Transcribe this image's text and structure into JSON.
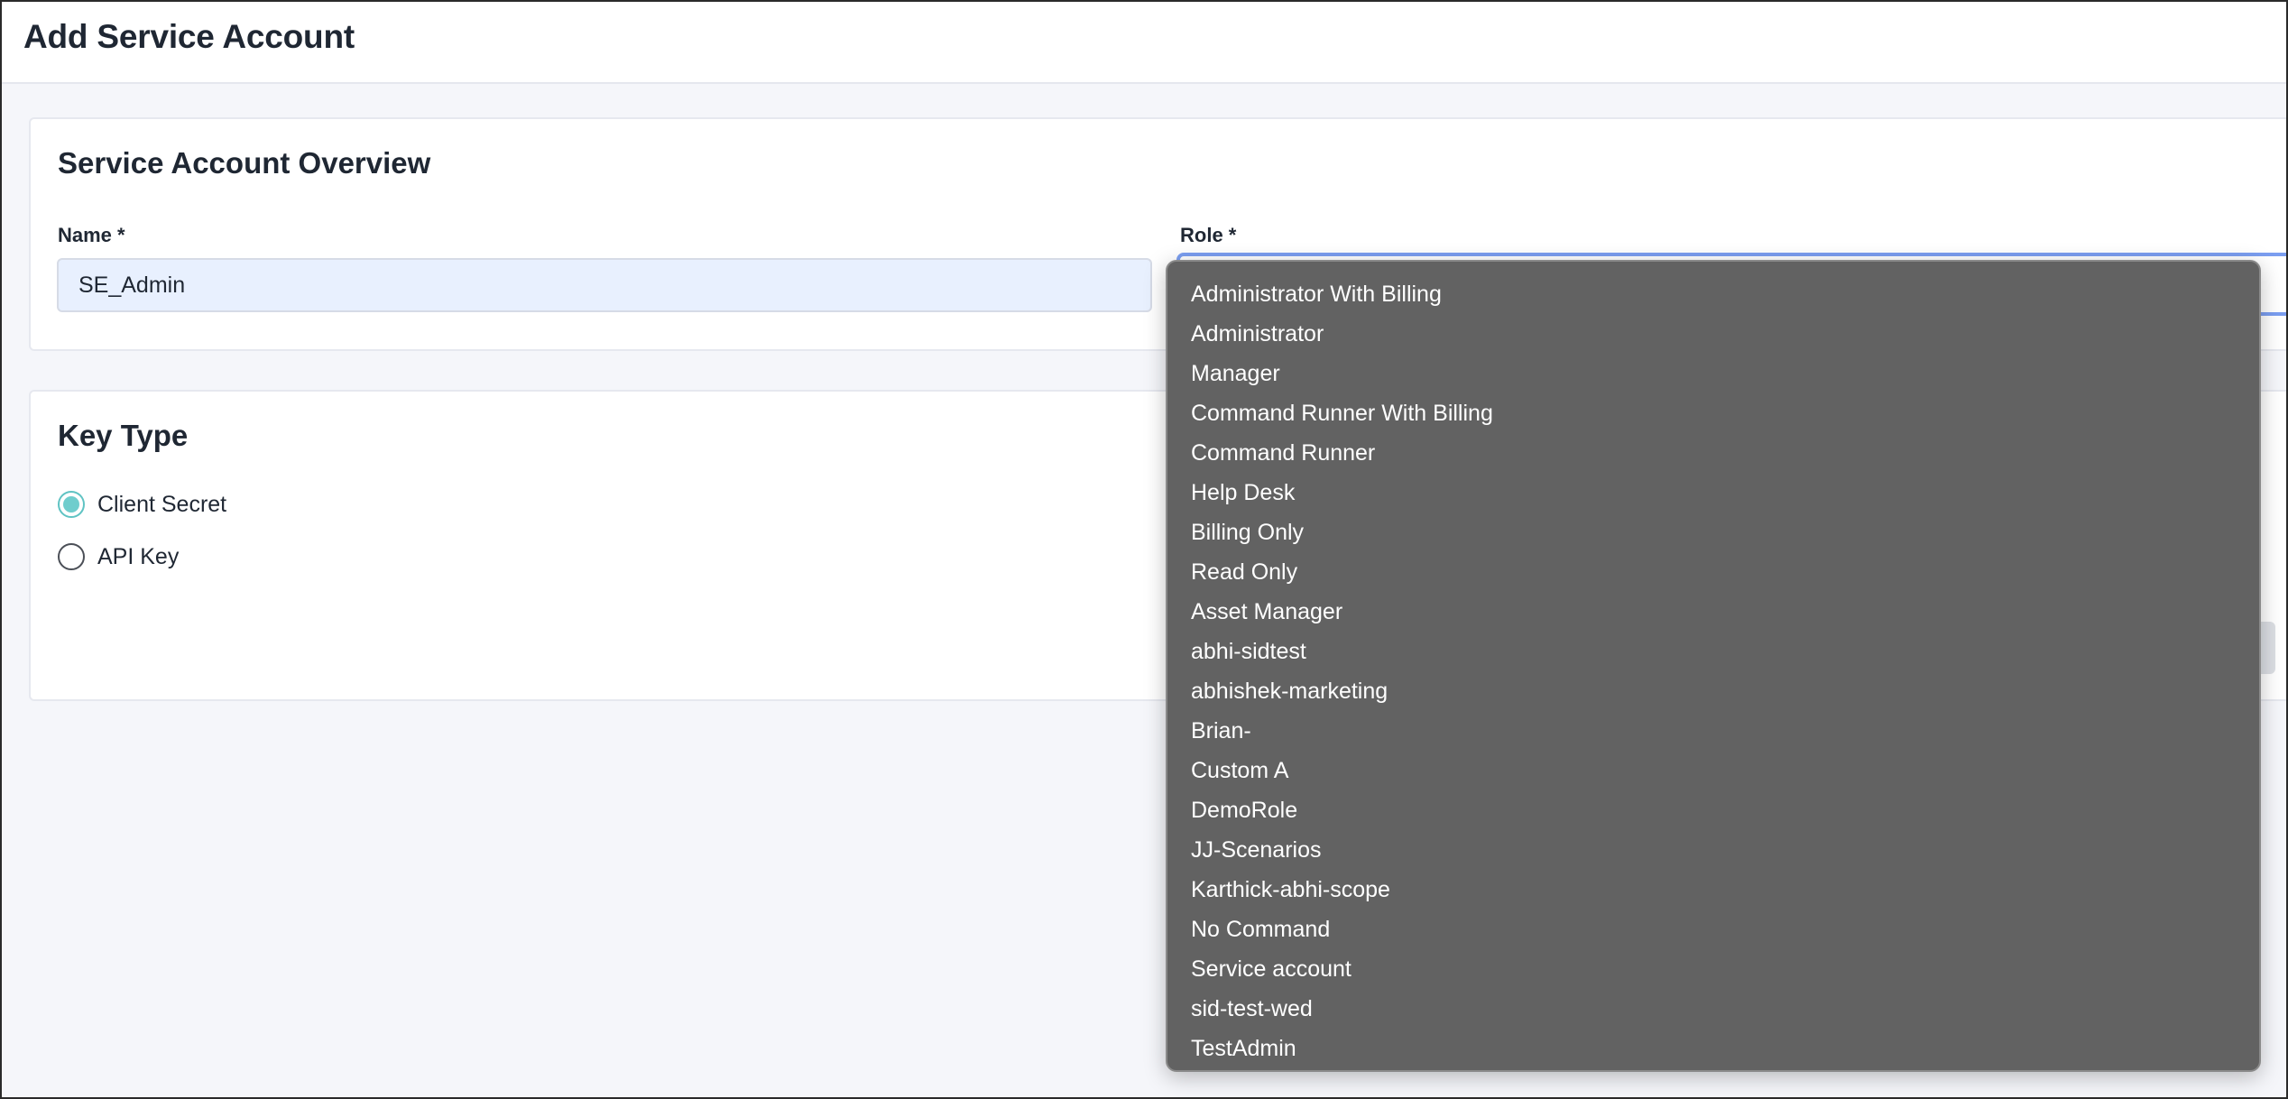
{
  "page": {
    "title": "Add Service Account"
  },
  "overview": {
    "title": "Service Account Overview",
    "name_label": "Name *",
    "name_value": "SE_Admin",
    "role_label": "Role *",
    "role_value": ""
  },
  "key_type": {
    "title": "Key Type",
    "options": [
      {
        "label": "Client Secret",
        "selected": true
      },
      {
        "label": "API Key",
        "selected": false
      }
    ]
  },
  "role_dropdown": {
    "options": [
      "Administrator With Billing",
      "Administrator",
      "Manager",
      "Command Runner With Billing",
      "Command Runner",
      "Help Desk",
      "Billing Only",
      "Read Only",
      "Asset Manager",
      "abhi-sidtest",
      "abhishek-marketing",
      "Brian-",
      "Custom A",
      "DemoRole",
      "JJ-Scenarios",
      "Karthick-abhi-scope",
      "No Command",
      "Service account",
      "sid-test-wed",
      "TestAdmin"
    ]
  },
  "colors": {
    "accent_radio": "#6fcdcd",
    "focus_border": "#7b9ef0",
    "dropdown_bg": "#626262",
    "name_input_bg": "#e8f0fe"
  }
}
